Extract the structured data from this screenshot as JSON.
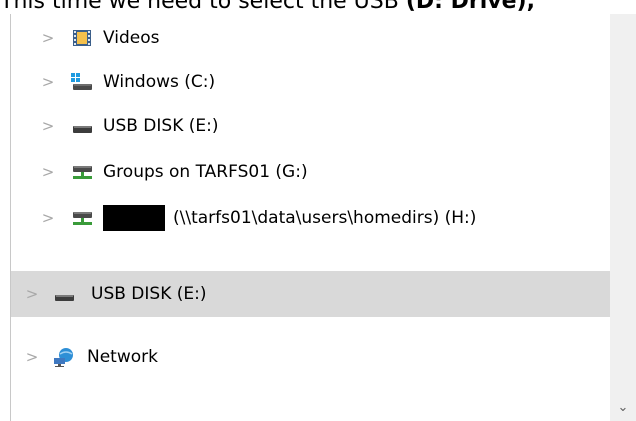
{
  "caption": {
    "text_before": "This time we need to select the USB ",
    "text_bold": "(D: Drive),"
  },
  "tree": {
    "items": [
      {
        "label": "Videos",
        "icon": "videos-folder-icon"
      },
      {
        "label": "Windows (C:)",
        "icon": "windows-drive-icon"
      },
      {
        "label": "USB DISK (E:)",
        "icon": "usb-drive-icon"
      },
      {
        "label": "Groups on TARFS01 (G:)",
        "icon": "network-drive-icon"
      },
      {
        "label": "(\\\\tarfs01\\data\\users\\homedirs) (H:)",
        "icon": "network-drive-icon"
      },
      {
        "label": "USB DISK (E:)",
        "icon": "usb-drive-icon",
        "selected": true
      },
      {
        "label": "Network",
        "icon": "network-icon"
      }
    ],
    "chevron": ">"
  },
  "scrollbar": {
    "down_arrow": "⌄"
  },
  "colors": {
    "selected_row": "#d9d9d9",
    "chevron": "#a8a8a8",
    "drive_green": "#3a9b3a"
  }
}
